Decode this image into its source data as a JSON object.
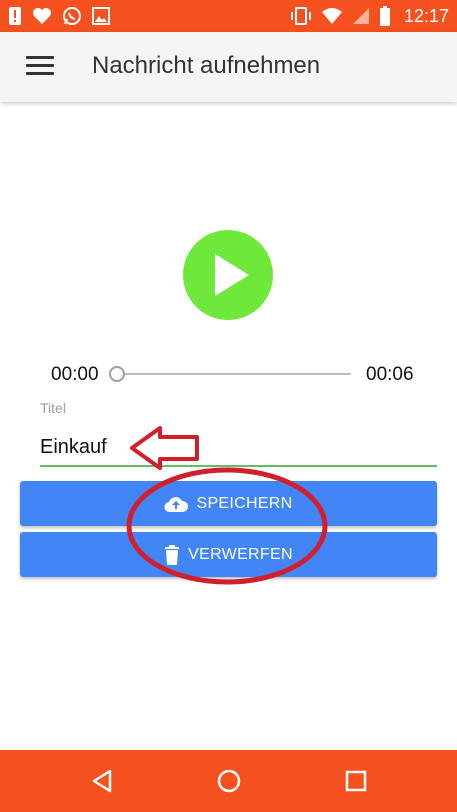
{
  "status_bar": {
    "time": "12:17",
    "left_icons": [
      "alert-icon",
      "heart-icon",
      "whatsapp-icon",
      "image-icon"
    ],
    "right_icons": [
      "vibrate-icon",
      "wifi-icon",
      "signal-icon",
      "battery-icon"
    ]
  },
  "app_bar": {
    "title": "Nachricht aufnehmen",
    "menu_icon": "hamburger-menu-icon"
  },
  "player": {
    "play_icon": "play-icon",
    "color": "#6ee83a",
    "current_time": "00:00",
    "duration": "00:06",
    "progress": 0
  },
  "title_field": {
    "label": "Titel",
    "value": "Einkauf",
    "underline_color": "#66bb6a"
  },
  "buttons": {
    "save": {
      "label": "SPEICHERN",
      "icon": "cloud-upload-icon"
    },
    "discard": {
      "label": "VERWERFEN",
      "icon": "trash-icon"
    },
    "color": "#4285f4"
  },
  "nav_bar": {
    "color": "#f4511e",
    "icons": [
      "back-icon",
      "home-icon",
      "recents-icon"
    ]
  },
  "annotations": {
    "color": "#d21f2c",
    "items": [
      "arrow-pointing-at-title",
      "ellipse-around-buttons"
    ]
  }
}
